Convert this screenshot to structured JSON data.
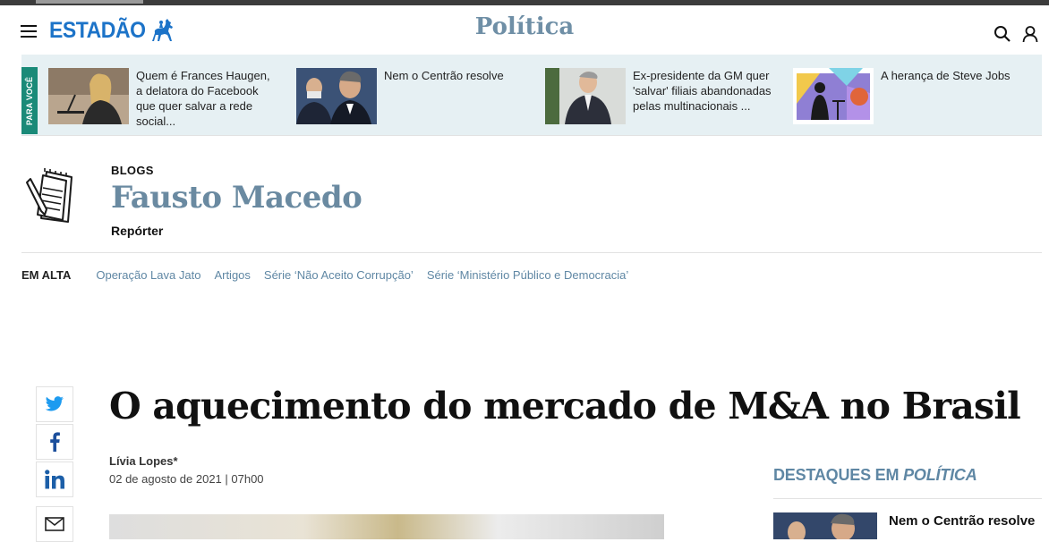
{
  "header": {
    "logo_text": "ESTADÃO",
    "section": "Política"
  },
  "for_you": {
    "label": "PARA VOCÊ",
    "items": [
      {
        "text": "Quem é Frances Haugen, a delatora do Facebook que quer salvar a rede social..."
      },
      {
        "text": "Nem o Centrão resolve"
      },
      {
        "text": "Ex-presidente da GM quer 'salvar' filiais abandonadas pelas multinacionais ..."
      },
      {
        "text": "A herança de Steve Jobs"
      }
    ]
  },
  "blog": {
    "category": "BLOGS",
    "name": "Fausto Macedo",
    "role": "Repórter"
  },
  "trending": {
    "label": "EM ALTA",
    "links": [
      "Operação Lava Jato",
      "Artigos",
      "Série ‘Não Aceito Corrupção’",
      "Série ‘Ministério Público e Democracia’"
    ]
  },
  "article": {
    "title": "O aquecimento do mercado de M&A no Brasil",
    "author": "Lívia Lopes*",
    "date": "02 de agosto de 2021 | 07h00"
  },
  "share_icons": [
    "twitter-icon",
    "facebook-icon",
    "linkedin-icon",
    "email-icon"
  ],
  "highlights": {
    "prefix": "DESTAQUES EM ",
    "section": "POLÍTICA",
    "first_headline": "Nem o Centrão resolve"
  },
  "colors": {
    "brand_blue": "#1c73c8",
    "section_blue": "#6f8fa6",
    "link_blue": "#5f87a4",
    "for_you_bg": "#e6f0f3",
    "for_you_tab": "#1a8a78"
  }
}
